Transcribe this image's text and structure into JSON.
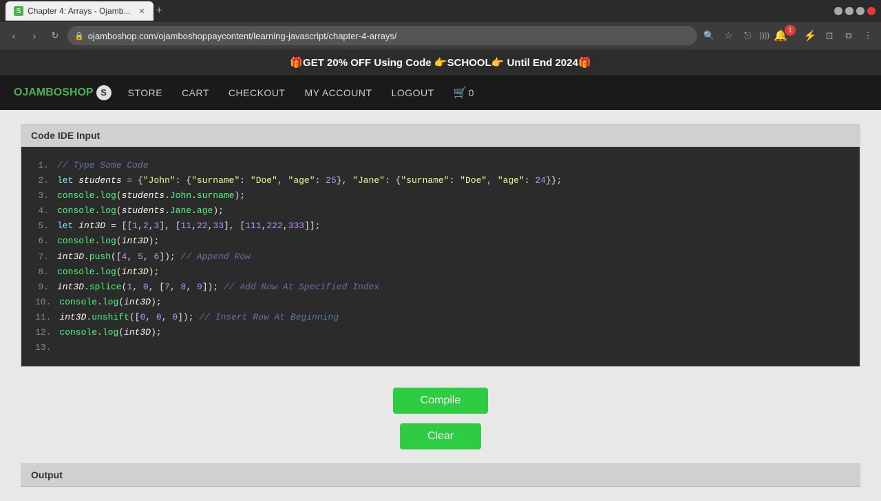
{
  "browser": {
    "tab_title": "Chapter 4: Arrays - Ojamb...",
    "url": "ojamboshop.com/ojamboshoppaycontent/learning-javascript/chapter-4-arrays/",
    "tab_favicon": "S",
    "window_title": "Chapter 4: Arrays - Ojamb..."
  },
  "promo": {
    "text": "🎁GET 20% OFF Using Code 👉SCHOOL👉 Until End 2024🎁"
  },
  "nav": {
    "logo_text": "OJAMBOSHOP",
    "logo_letter": "S",
    "links": [
      {
        "label": "STORE",
        "id": "store"
      },
      {
        "label": "CART",
        "id": "cart"
      },
      {
        "label": "CHECKOUT",
        "id": "checkout"
      },
      {
        "label": "MY ACCOUNT",
        "id": "my-account"
      },
      {
        "label": "LOGOUT",
        "id": "logout"
      }
    ],
    "cart_icon": "🛒",
    "cart_count": "0"
  },
  "code_ide": {
    "header": "Code IDE Input",
    "lines": [
      {
        "num": "1.",
        "content": "// Type Some Code"
      },
      {
        "num": "2.",
        "content": "let students = {\"John\": {\"surname\": \"Doe\",  \"age\": 25}, \"Jane\": {\"surname\": \"Doe\",  \"age\": 24}};"
      },
      {
        "num": "3.",
        "content": "console.log(students.John.surname);"
      },
      {
        "num": "4.",
        "content": "console.log(students.Jane.age);"
      },
      {
        "num": "5.",
        "content": "let int3D = [[1,2,3],  [11,22,33],  [111,222,333]];"
      },
      {
        "num": "6.",
        "content": "console.log(int3D);"
      },
      {
        "num": "7.",
        "content": "int3D.push([4, 5, 6]); // Append Row"
      },
      {
        "num": "8.",
        "content": "console.log(int3D);"
      },
      {
        "num": "9.",
        "content": "int3D.splice(1, 0, [7, 8, 9]); // Add Row At Specified Index"
      },
      {
        "num": "10.",
        "content": "console.log(int3D);"
      },
      {
        "num": "11.",
        "content": "int3D.unshift([0, 0, 0]); // Insert Row At Beginning"
      },
      {
        "num": "12.",
        "content": "console.log(int3D);"
      },
      {
        "num": "13.",
        "content": ""
      }
    ]
  },
  "buttons": {
    "compile_label": "Compile",
    "clear_label": "Clear"
  },
  "output": {
    "header": "Output"
  }
}
